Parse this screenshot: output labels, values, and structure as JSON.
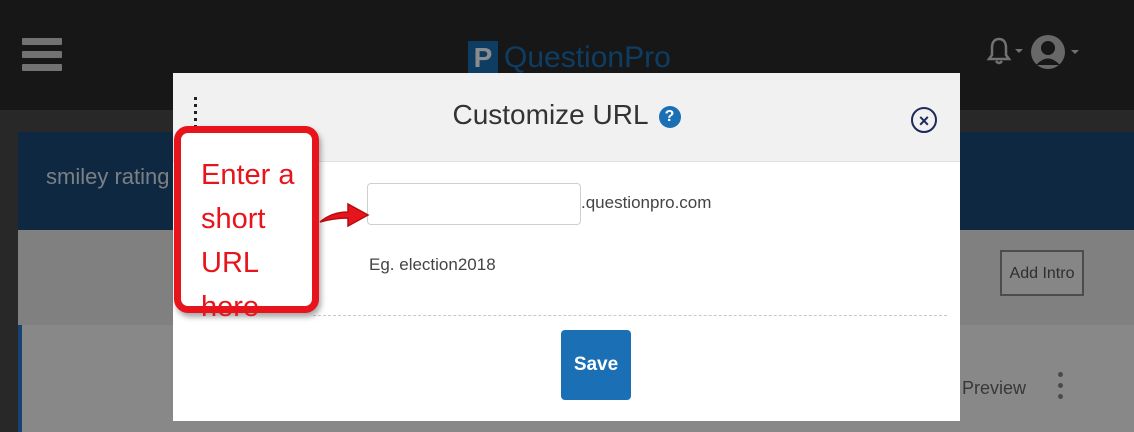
{
  "app": {
    "logo_text": "QuestionPro",
    "survey_title": "smiley rating",
    "add_intro_label": "Add Intro",
    "preview_label": "Preview"
  },
  "modal": {
    "title": "Customize URL",
    "help_glyph": "?",
    "close_glyph": "×",
    "url_input": {
      "value": "",
      "placeholder": ""
    },
    "domain_suffix": ".questionpro.com",
    "example": "Eg. election2018",
    "save_label": "Save"
  },
  "annotation": {
    "text": "Enter a short URL here",
    "color": "#e8141b"
  },
  "icons": [
    "hamburger-icon",
    "bell-icon",
    "user-icon",
    "drag-handle-icon",
    "help-icon",
    "close-icon",
    "kebab-icon",
    "arrow-icon"
  ],
  "colors": {
    "accent": "#1a6fb5",
    "header": "#1d4a78",
    "annotation": "#e8141b"
  }
}
